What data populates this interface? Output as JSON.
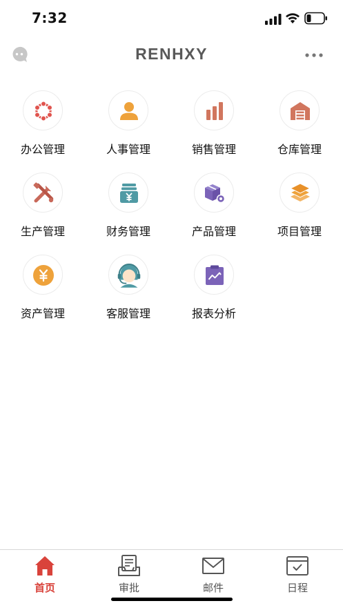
{
  "status_bar": {
    "time": "7:32"
  },
  "nav": {
    "brand": "RENHXY"
  },
  "modules": [
    {
      "label": "办公管理",
      "icon": "office-network-icon",
      "color": "#e0544e"
    },
    {
      "label": "人事管理",
      "icon": "person-icon",
      "color": "#eea23b"
    },
    {
      "label": "销售管理",
      "icon": "bar-chart-icon",
      "color": "#d1765e"
    },
    {
      "label": "仓库管理",
      "icon": "warehouse-icon",
      "color": "#d1765e"
    },
    {
      "label": "生产管理",
      "icon": "tools-icon",
      "color": "#c8695a"
    },
    {
      "label": "财务管理",
      "icon": "money-box-icon",
      "color": "#4f9aa4"
    },
    {
      "label": "产品管理",
      "icon": "product-box-icon",
      "color": "#7b63b8"
    },
    {
      "label": "项目管理",
      "icon": "layers-icon",
      "color": "#eea23b"
    },
    {
      "label": "资产管理",
      "icon": "coin-icon",
      "color": "#eea23b"
    },
    {
      "label": "客服管理",
      "icon": "customer-service-icon",
      "color": "#4f9aa4"
    },
    {
      "label": "报表分析",
      "icon": "report-icon",
      "color": "#7b63b8"
    }
  ],
  "tabs": [
    {
      "label": "首页",
      "icon": "home-icon",
      "active": true
    },
    {
      "label": "审批",
      "icon": "approval-inbox-icon",
      "active": false
    },
    {
      "label": "邮件",
      "icon": "mail-icon",
      "active": false
    },
    {
      "label": "日程",
      "icon": "calendar-icon",
      "active": false
    }
  ],
  "colors": {
    "accent": "#d9433b",
    "brand_text": "#595959",
    "tab_inactive": "#555555"
  }
}
